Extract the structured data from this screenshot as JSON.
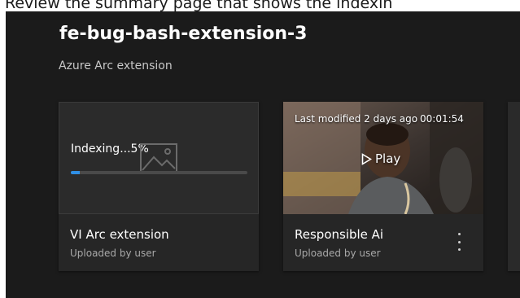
{
  "caption": "Review the summary page that shows the indexin",
  "header": {
    "title": "fe-bug-bash-extension-3",
    "subtitle": "Azure Arc extension"
  },
  "cards": [
    {
      "status_text": "Indexing...5%",
      "progress_percent": 5,
      "name": "VI Arc extension",
      "uploaded_by": "Uploaded by user",
      "thumbnail_icon": "image-placeholder-icon"
    },
    {
      "last_modified": "Last modified 2 days ago",
      "duration": "00:01:54",
      "play_label": "Play",
      "name": "Responsible Ai",
      "uploaded_by": "Uploaded by user",
      "more_icon": "more-vertical-icon"
    }
  ],
  "colors": {
    "background": "#1b1b1b",
    "card": "#262626",
    "progress": "#2f8fe5"
  }
}
